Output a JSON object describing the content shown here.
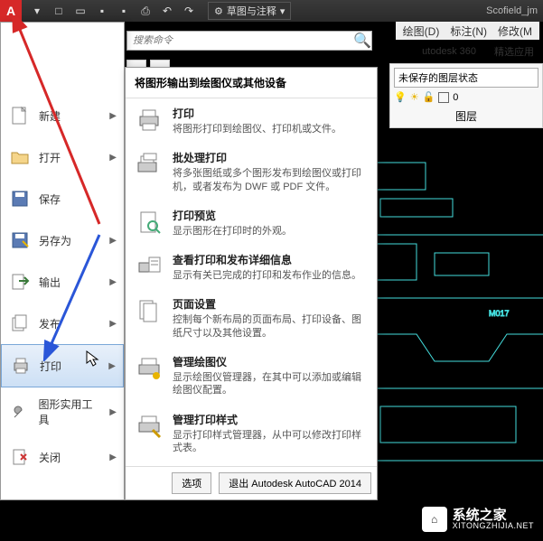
{
  "titlebar": {
    "app_letter": "A",
    "workspace": "草图与注释",
    "user": "Scofield_jm"
  },
  "menubar_right": {
    "draw": "绘图(D)",
    "annotate": "标注(N)",
    "modify": "修改(M"
  },
  "ribbon_right": {
    "a360": "utodesk 360",
    "featured": "精选应用"
  },
  "search": {
    "placeholder": "搜索命令"
  },
  "layer_panel": {
    "state": "未保存的图层状态",
    "label": "图层",
    "zero": "0"
  },
  "app_menu": {
    "items": [
      {
        "label": "新建",
        "icon": "file-new"
      },
      {
        "label": "打开",
        "icon": "folder-open"
      },
      {
        "label": "保存",
        "icon": "save"
      },
      {
        "label": "另存为",
        "icon": "save-as"
      },
      {
        "label": "输出",
        "icon": "export"
      },
      {
        "label": "发布",
        "icon": "publish"
      },
      {
        "label": "打印",
        "icon": "print",
        "selected": true
      },
      {
        "label": "图形实用工具",
        "icon": "wrench"
      },
      {
        "label": "关闭",
        "icon": "close-doc"
      }
    ]
  },
  "submenu": {
    "header": "将图形输出到绘图仪或其他设备",
    "items": [
      {
        "title": "打印",
        "desc": "将图形打印到绘图仪、打印机或文件。",
        "icon": "printer"
      },
      {
        "title": "批处理打印",
        "desc": "将多张图纸或多个图形发布到绘图仪或打印机，或者发布为 DWF 或 PDF 文件。",
        "icon": "printer-batch"
      },
      {
        "title": "打印预览",
        "desc": "显示图形在打印时的外观。",
        "icon": "page-preview"
      },
      {
        "title": "查看打印和发布详细信息",
        "desc": "显示有关已完成的打印和发布作业的信息。",
        "icon": "page-info"
      },
      {
        "title": "页面设置",
        "desc": "控制每个新布局的页面布局、打印设备、图纸尺寸以及其他设置。",
        "icon": "page-setup"
      },
      {
        "title": "管理绘图仪",
        "desc": "显示绘图仪管理器，在其中可以添加或编辑绘图仪配置。",
        "icon": "plotter"
      },
      {
        "title": "管理打印样式",
        "desc": "显示打印样式管理器，从中可以修改打印样式表。",
        "icon": "print-style"
      }
    ],
    "footer": {
      "options": "选项",
      "exit": "退出 Autodesk AutoCAD 2014"
    }
  },
  "watermark": {
    "name": "系统之家",
    "url": "XITONGZHIJIA.NET"
  }
}
